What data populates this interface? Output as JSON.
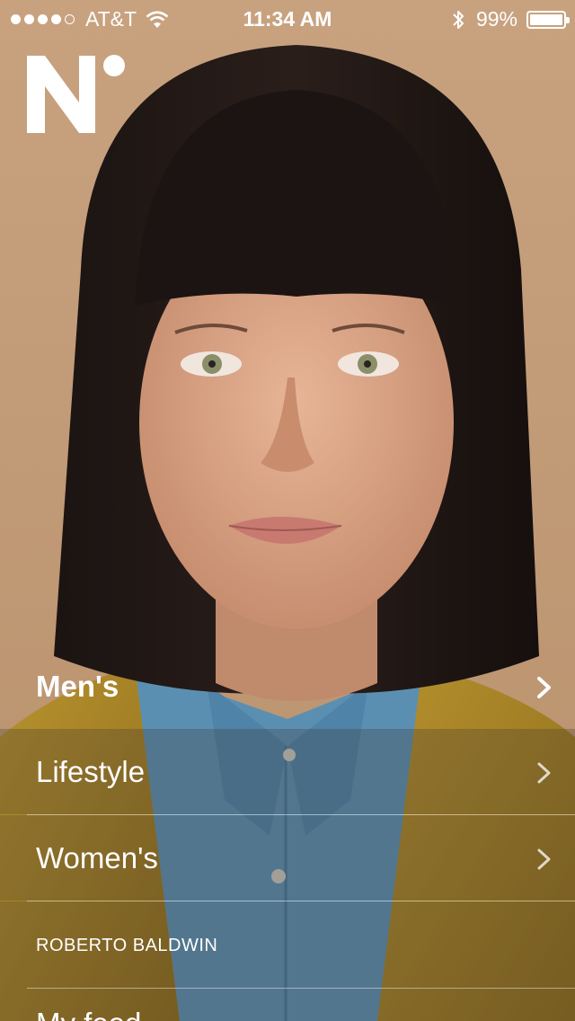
{
  "status_bar": {
    "signal_strength": "4 of 5",
    "carrier": "AT&T",
    "time": "11:34 AM",
    "battery_percent": "99%",
    "battery_level": 0.99
  },
  "logo": {
    "icon": "n-dot-logo"
  },
  "menu": {
    "items": [
      {
        "label": "Men's",
        "icon": "chevron-right-icon",
        "active": true
      },
      {
        "label": "Lifestyle",
        "icon": "chevron-right-icon"
      },
      {
        "label": "Women's",
        "icon": "chevron-right-icon"
      }
    ],
    "section_header": "ROBERTO BALDWIN",
    "partial_item": "My feed"
  },
  "colors": {
    "background": "#c9a07e",
    "text": "#ffffff",
    "hair": "#1a1210",
    "jacket": "#b08a28",
    "shirt": "#5a8fb3"
  }
}
